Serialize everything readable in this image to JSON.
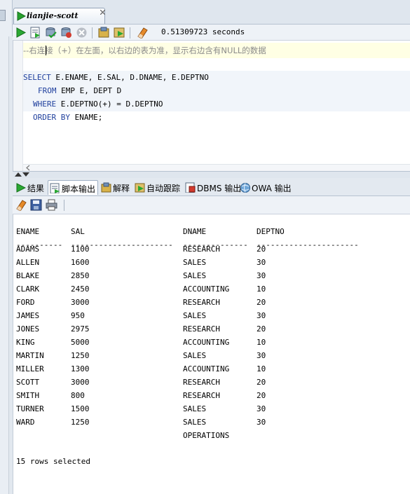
{
  "tab": {
    "title": "lianjie-scott"
  },
  "toolbar": {
    "timing": "0.51309723 seconds"
  },
  "editor": {
    "comment": "--右连接（+）在左面，以右边的表为准，显示右边含有NULL的数据",
    "lines": [
      {
        "kw": "SELECT",
        "rest": " E.ENAME, E.SAL, D.DNAME, E.DEPTNO"
      },
      {
        "kw": "FROM",
        "rest": " EMP E, DEPT D"
      },
      {
        "kw": "WHERE",
        "rest": " E.DEPTNO(+) = D.DEPTNO"
      },
      {
        "kw": "ORDER BY",
        "rest": " ENAME;"
      }
    ]
  },
  "results_tabs": [
    "结果",
    "脚本输出",
    "解释",
    "自动跟踪",
    "DBMS 输出",
    "OWA 输出"
  ],
  "output": {
    "headers": [
      "ENAME",
      "SAL",
      "DNAME",
      "DEPTNO"
    ],
    "dashes": [
      "----------",
      "----------------------",
      "--------------",
      "----------------------"
    ],
    "rows": [
      [
        "ADAMS",
        "1100",
        "RESEARCH",
        "20"
      ],
      [
        "ALLEN",
        "1600",
        "SALES",
        "30"
      ],
      [
        "BLAKE",
        "2850",
        "SALES",
        "30"
      ],
      [
        "CLARK",
        "2450",
        "ACCOUNTING",
        "10"
      ],
      [
        "FORD",
        "3000",
        "RESEARCH",
        "20"
      ],
      [
        "JAMES",
        "950",
        "SALES",
        "30"
      ],
      [
        "JONES",
        "2975",
        "RESEARCH",
        "20"
      ],
      [
        "KING",
        "5000",
        "ACCOUNTING",
        "10"
      ],
      [
        "MARTIN",
        "1250",
        "SALES",
        "30"
      ],
      [
        "MILLER",
        "1300",
        "ACCOUNTING",
        "10"
      ],
      [
        "SCOTT",
        "3000",
        "RESEARCH",
        "20"
      ],
      [
        "SMITH",
        "800",
        "RESEARCH",
        "20"
      ],
      [
        "TURNER",
        "1500",
        "SALES",
        "30"
      ],
      [
        "WARD",
        "1250",
        "SALES",
        "30"
      ],
      [
        "",
        "",
        "OPERATIONS",
        ""
      ]
    ],
    "footer": "15 rows selected"
  }
}
